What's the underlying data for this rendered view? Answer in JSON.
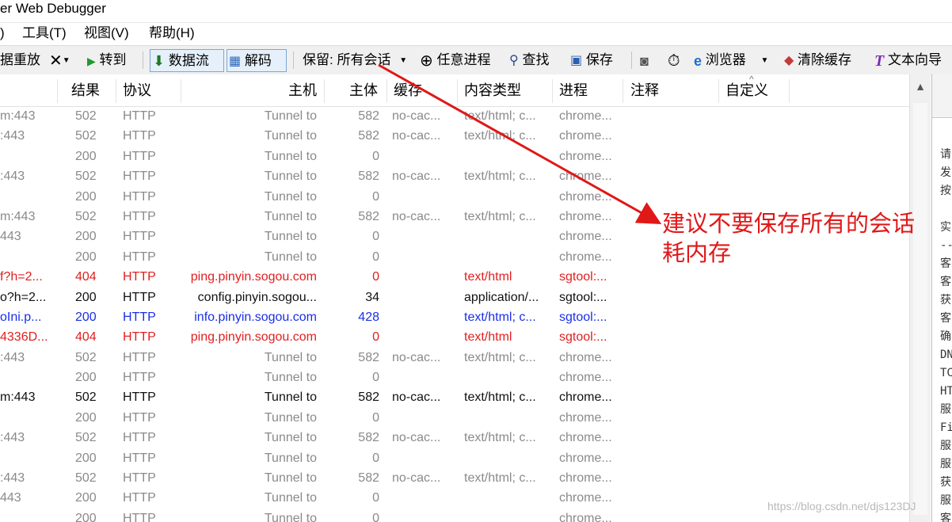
{
  "window": {
    "title": "er Web Debugger"
  },
  "menu": [
    {
      "label": ")"
    },
    {
      "label": "工具(T)"
    },
    {
      "label": "视图(V)"
    },
    {
      "label": "帮助(H)"
    }
  ],
  "toolbar": {
    "replay": "据重放",
    "goto": "转到",
    "stream": "数据流",
    "decode": "解码",
    "keep": "保留: 所有会话",
    "any_process": "任意进程",
    "find": "查找",
    "save": "保存",
    "browser": "浏览器",
    "clear_cache": "清除缓存",
    "text_wizard": "文本向导"
  },
  "columns": [
    "结果",
    "协议",
    "主机",
    "主体",
    "缓存",
    "内容类型",
    "进程",
    "注释",
    "自定义"
  ],
  "rows": [
    {
      "url": "m:443",
      "result": "502",
      "proto": "HTTP",
      "host": "Tunnel to",
      "body": "582",
      "cache": "no-cac...",
      "ctype": "text/html; c...",
      "proc": "chrome...",
      "style": "gray"
    },
    {
      "url": ":443",
      "result": "502",
      "proto": "HTTP",
      "host": "Tunnel to",
      "body": "582",
      "cache": "no-cac...",
      "ctype": "text/html; c...",
      "proc": "chrome...",
      "style": "gray"
    },
    {
      "url": "",
      "result": "200",
      "proto": "HTTP",
      "host": "Tunnel to",
      "body": "0",
      "cache": "",
      "ctype": "",
      "proc": "chrome...",
      "style": "gray"
    },
    {
      "url": ":443",
      "result": "502",
      "proto": "HTTP",
      "host": "Tunnel to",
      "body": "582",
      "cache": "no-cac...",
      "ctype": "text/html; c...",
      "proc": "chrome...",
      "style": "gray"
    },
    {
      "url": "",
      "result": "200",
      "proto": "HTTP",
      "host": "Tunnel to",
      "body": "0",
      "cache": "",
      "ctype": "",
      "proc": "chrome...",
      "style": "gray"
    },
    {
      "url": "m:443",
      "result": "502",
      "proto": "HTTP",
      "host": "Tunnel to",
      "body": "582",
      "cache": "no-cac...",
      "ctype": "text/html; c...",
      "proc": "chrome...",
      "style": "gray"
    },
    {
      "url": "443",
      "result": "200",
      "proto": "HTTP",
      "host": "Tunnel to",
      "body": "0",
      "cache": "",
      "ctype": "",
      "proc": "chrome...",
      "style": "gray"
    },
    {
      "url": "",
      "result": "200",
      "proto": "HTTP",
      "host": "Tunnel to",
      "body": "0",
      "cache": "",
      "ctype": "",
      "proc": "chrome...",
      "style": "gray"
    },
    {
      "url": "f?h=2...",
      "result": "404",
      "proto": "HTTP",
      "host": "ping.pinyin.sogou.com",
      "body": "0",
      "cache": "",
      "ctype": "text/html",
      "proc": "sgtool:...",
      "style": "red"
    },
    {
      "url": "o?h=2...",
      "result": "200",
      "proto": "HTTP",
      "host": "config.pinyin.sogou...",
      "body": "34",
      "cache": "",
      "ctype": "application/...",
      "proc": "sgtool:...",
      "style": "black"
    },
    {
      "url": "oIni.p...",
      "result": "200",
      "proto": "HTTP",
      "host": "info.pinyin.sogou.com",
      "body": "428",
      "cache": "",
      "ctype": "text/html; c...",
      "proc": "sgtool:...",
      "style": "blue"
    },
    {
      "url": "4336D...",
      "result": "404",
      "proto": "HTTP",
      "host": "ping.pinyin.sogou.com",
      "body": "0",
      "cache": "",
      "ctype": "text/html",
      "proc": "sgtool:...",
      "style": "red"
    },
    {
      "url": ":443",
      "result": "502",
      "proto": "HTTP",
      "host": "Tunnel to",
      "body": "582",
      "cache": "no-cac...",
      "ctype": "text/html; c...",
      "proc": "chrome...",
      "style": "gray"
    },
    {
      "url": "",
      "result": "200",
      "proto": "HTTP",
      "host": "Tunnel to",
      "body": "0",
      "cache": "",
      "ctype": "",
      "proc": "chrome...",
      "style": "gray"
    },
    {
      "url": "m:443",
      "result": "502",
      "proto": "HTTP",
      "host": "Tunnel to",
      "body": "582",
      "cache": "no-cac...",
      "ctype": "text/html; c...",
      "proc": "chrome...",
      "style": "black"
    },
    {
      "url": "",
      "result": "200",
      "proto": "HTTP",
      "host": "Tunnel to",
      "body": "0",
      "cache": "",
      "ctype": "",
      "proc": "chrome...",
      "style": "gray"
    },
    {
      "url": ":443",
      "result": "502",
      "proto": "HTTP",
      "host": "Tunnel to",
      "body": "582",
      "cache": "no-cac...",
      "ctype": "text/html; c...",
      "proc": "chrome...",
      "style": "gray"
    },
    {
      "url": "",
      "result": "200",
      "proto": "HTTP",
      "host": "Tunnel to",
      "body": "0",
      "cache": "",
      "ctype": "",
      "proc": "chrome...",
      "style": "gray"
    },
    {
      "url": ":443",
      "result": "502",
      "proto": "HTTP",
      "host": "Tunnel to",
      "body": "582",
      "cache": "no-cac...",
      "ctype": "text/html; c...",
      "proc": "chrome...",
      "style": "gray"
    },
    {
      "url": "443",
      "result": "200",
      "proto": "HTTP",
      "host": "Tunnel to",
      "body": "0",
      "cache": "",
      "ctype": "",
      "proc": "chrome...",
      "style": "gray"
    },
    {
      "url": "",
      "result": "200",
      "proto": "HTTP",
      "host": "Tunnel to",
      "body": "0",
      "cache": "",
      "ctype": "",
      "proc": "chrome...",
      "style": "gray"
    }
  ],
  "right_pane_lines": [
    "请",
    "发",
    "按",
    "",
    "实",
    "--",
    "客",
    "客",
    "获",
    "客",
    "确",
    "DN",
    "TC",
    "HT",
    "服",
    "Fi",
    "服",
    "服",
    "获",
    "服",
    "客"
  ],
  "annotation": {
    "line1": "建议不要保存所有的会话",
    "line2": "耗内存"
  },
  "watermark": "https://blog.csdn.net/djs123DJ",
  "colors": {
    "annotation": "#e01818",
    "error_row": "#e02020",
    "info_row": "#1a2ee8",
    "tunnel_row": "#8a8a8a"
  }
}
